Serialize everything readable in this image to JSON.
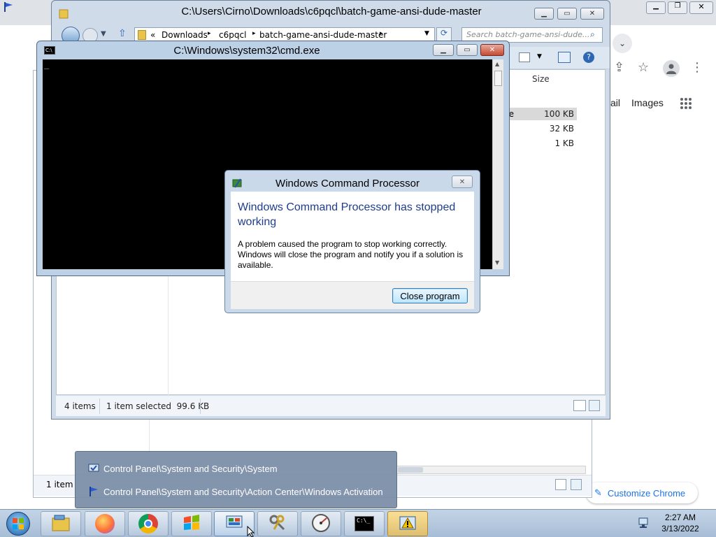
{
  "chrome": {
    "images_link": "Images",
    "mail_link_partial": "ail",
    "customize_label": "Customize Chrome",
    "footer_status": "1 item"
  },
  "explorer": {
    "title": "C:\\Users\\Cirno\\Downloads\\c6pqcl\\batch-game-ansi-dude-master",
    "breadcrumb": [
      "«",
      "Downloads",
      "c6pqcl",
      "batch-game-ansi-dude-master"
    ],
    "search_placeholder": "Search batch-game-ansi-dude...",
    "column_size": "Size",
    "type_partial": "ile",
    "sizes": [
      "100 KB",
      "32 KB",
      "1 KB"
    ],
    "status_items": "4 items",
    "status_selected": "1 item selected  99.6 KB"
  },
  "cmd": {
    "title": "C:\\Windows\\system32\\cmd.exe",
    "cursor": "_"
  },
  "dialog": {
    "title": "Windows Command Processor",
    "heading": "Windows Command Processor has stopped working",
    "message": "A problem caused the program to stop working correctly. Windows will close the program and notify you if a solution is available.",
    "button": "Close program"
  },
  "popup": {
    "items": [
      "Control Panel\\System and Security\\System",
      "Control Panel\\System and Security\\Action Center\\Windows Activation"
    ]
  },
  "taskbar": {
    "time": "2:27 AM",
    "date": "3/13/2022"
  },
  "colors": {
    "dialog_heading": "#1f3d8c",
    "taskbar": "#b4c8de",
    "console": "#000000"
  }
}
